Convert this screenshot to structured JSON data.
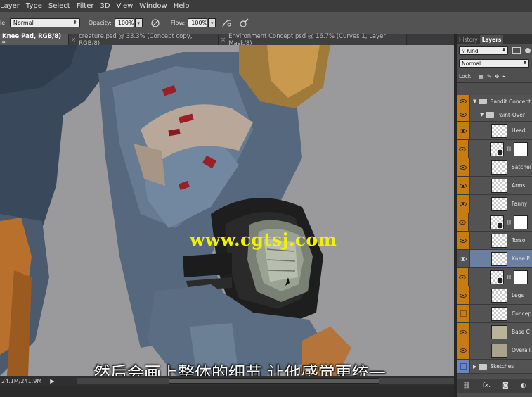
{
  "menu": {
    "items": [
      "Layer",
      "Type",
      "Select",
      "Filter",
      "3D",
      "View",
      "Window",
      "Help"
    ]
  },
  "options": {
    "mode_label": "le:",
    "mode_value": "Normal",
    "opacity_label": "Opacity:",
    "opacity_value": "100%",
    "flow_label": "Flow:",
    "flow_value": "100%"
  },
  "tabs": [
    {
      "label": "Knee Pad, RGB/8) *",
      "active": true
    },
    {
      "label": "creature.psd @ 33.3% (Concept copy, RGB/8)",
      "active": false
    },
    {
      "label": "Environment Concept.psd @ 16.7% (Curves 1, Layer Mask/8)",
      "active": false
    }
  ],
  "canvas": {
    "watermark": "www.cgtsj.com",
    "subtitle": "然后会画上整体的细节 让他感觉更统一"
  },
  "status": {
    "doc_size": "24.1M/241.9M",
    "play_glyph": "▶"
  },
  "panel": {
    "tabs": [
      "History",
      "Layers"
    ],
    "active_tab": "Layers",
    "filter_value": "Kind",
    "blend_value": "Normal",
    "lock_label": "Lock:",
    "layers": [
      {
        "name": "Bandit Concept",
        "type": "group",
        "indent": 0,
        "expanded": true,
        "visible": true
      },
      {
        "name": "Paint-Over",
        "type": "group",
        "indent": 1,
        "expanded": true,
        "visible": true
      },
      {
        "name": "Head",
        "type": "layer",
        "visible": true,
        "selected": false,
        "mask": false
      },
      {
        "name": "",
        "type": "layer",
        "visible": true,
        "selected": false,
        "mask": true
      },
      {
        "name": "Satchel",
        "type": "layer",
        "visible": true,
        "selected": false,
        "mask": false
      },
      {
        "name": "Arms",
        "type": "layer",
        "visible": true,
        "selected": false,
        "mask": false
      },
      {
        "name": "Fanny",
        "type": "layer",
        "visible": true,
        "selected": false,
        "mask": false
      },
      {
        "name": "",
        "type": "layer",
        "visible": true,
        "selected": false,
        "mask": true
      },
      {
        "name": "Torso",
        "type": "layer",
        "visible": true,
        "selected": false,
        "mask": false
      },
      {
        "name": "Knee P",
        "type": "layer",
        "visible": true,
        "selected": true,
        "mask": false
      },
      {
        "name": "",
        "type": "layer",
        "visible": true,
        "selected": false,
        "mask": true
      },
      {
        "name": "Legs",
        "type": "layer",
        "visible": true,
        "selected": false,
        "mask": false
      },
      {
        "name": "Concep",
        "type": "layer",
        "visible": false,
        "selected": false,
        "mask": false
      },
      {
        "name": "Base C",
        "type": "layer",
        "visible": true,
        "selected": false,
        "mask": false
      },
      {
        "name": "Overall",
        "type": "layer",
        "visible": true,
        "selected": false,
        "mask": false
      },
      {
        "name": "Sketches",
        "type": "group",
        "indent": 0,
        "expanded": false,
        "visible": false
      }
    ],
    "bottom_fx": "fx."
  },
  "colors": {
    "eye_orange": "#c77c12",
    "selected_layer": "#6b7fa0",
    "watermark": "#f2f200"
  }
}
